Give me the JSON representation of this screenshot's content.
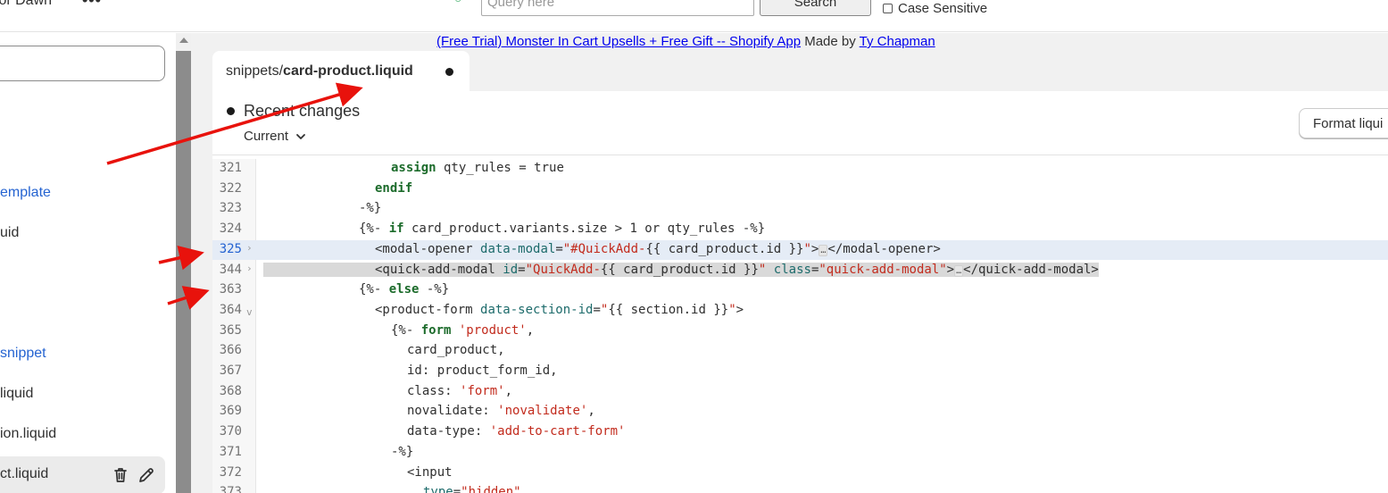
{
  "topbar": {
    "theme_name": "for Dawn",
    "more_label": "•••",
    "status_glyph": "○",
    "query_placeholder": "Query here",
    "search_label": "Search",
    "case_sensitive_label": "Case Sensitive"
  },
  "sidebar": {
    "items": [
      {
        "label": "emplate",
        "type": "link"
      },
      {
        "label": "uid",
        "type": "file"
      },
      {
        "label": "snippet",
        "type": "link"
      },
      {
        "label": "liquid",
        "type": "file"
      },
      {
        "label": "ion.liquid",
        "type": "file"
      },
      {
        "label": "ct.liquid",
        "type": "file-active"
      }
    ],
    "delete_icon": "trash-icon",
    "rename_icon": "pencil-icon"
  },
  "credit": {
    "app_link": "(Free Trial) Monster In Cart Upsells + Free Gift -- Shopify App",
    "made_by": " Made by ",
    "author": "Ty Chapman"
  },
  "file_tab": {
    "folder": "snippets/",
    "filename": "card-product.liquid",
    "unsaved_indicator": "●"
  },
  "panel": {
    "recent_changes": "Recent changes",
    "version_select": "Current",
    "format_button": "Format liqui"
  },
  "code": {
    "lines": [
      {
        "num": "321",
        "text": "assign qty_rules = true"
      },
      {
        "num": "322",
        "text": "endif"
      },
      {
        "num": "323",
        "text": "-%}"
      },
      {
        "num": "324",
        "text": "{%- if card_product.variants.size > 1 or qty_rules -%}"
      },
      {
        "num": "325",
        "text": "<modal-opener data-modal=\"#QuickAdd-{{ card_product.id }}\">…</modal-opener>",
        "folded": true
      },
      {
        "num": "344",
        "text": "<quick-add-modal id=\"QuickAdd-{{ card_product.id }}\" class=\"quick-add-modal\">…</quick-add-modal>",
        "folded": true
      },
      {
        "num": "363",
        "text": "{%- else -%}"
      },
      {
        "num": "364",
        "text": "<product-form data-section-id=\"{{ section.id }}\">",
        "foldable": true
      },
      {
        "num": "365",
        "text": "{%- form 'product',"
      },
      {
        "num": "366",
        "text": "card_product,"
      },
      {
        "num": "367",
        "text": "id: product_form_id,"
      },
      {
        "num": "368",
        "text": "class: 'form',"
      },
      {
        "num": "369",
        "text": "novalidate: 'novalidate',"
      },
      {
        "num": "370",
        "text": "data-type: 'add-to-cart-form'"
      },
      {
        "num": "371",
        "text": "-%}"
      },
      {
        "num": "372",
        "text": "<input"
      },
      {
        "num": "373",
        "text": "type=\"hidden\""
      }
    ]
  },
  "colors": {
    "link": "#0000ee",
    "sidebar_link": "#2463d1",
    "keyword": "#1c6b2b",
    "string": "#c22b1d",
    "annotation_arrow": "#e8120c",
    "highlight_row": "#e5ecf6",
    "highlight_row_2": "#d9d9d9"
  }
}
